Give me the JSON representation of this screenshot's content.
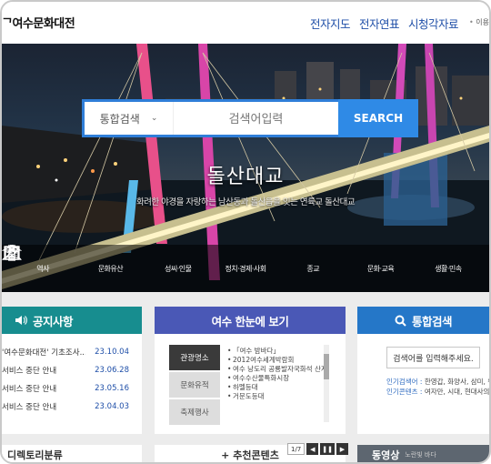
{
  "header": {
    "logo": "ᄀ여수문화대전",
    "nav": [
      "전자지도",
      "전자연표",
      "시청각자료"
    ],
    "util": "이용"
  },
  "search": {
    "select_label": "통합검색",
    "placeholder": "검색어입력",
    "button_label": "SEARCH"
  },
  "hero": {
    "title": "돌산대교",
    "subtitle": "화려한 야경을 자랑하는 남산동과 돌산읍을 잇는 연륙교 돌산대교"
  },
  "categories": [
    {
      "label": "역사",
      "icon": "hourglass-icon"
    },
    {
      "label": "문화유산",
      "icon": "temple-icon"
    },
    {
      "label": "성씨·인물",
      "icon": "people-icon"
    },
    {
      "label": "정치·경제·사회",
      "icon": "gavel-icon"
    },
    {
      "label": "종교",
      "icon": "candle-icon"
    },
    {
      "label": "문화·교육",
      "icon": "book-icon"
    },
    {
      "label": "생활·민속",
      "icon": "house-icon"
    }
  ],
  "notice": {
    "title": "공지사항",
    "items": [
      {
        "text": "'여수문화대전' 기초조사...",
        "date": "23.10.04"
      },
      {
        "text": "서비스 중단 안내",
        "date": "23.06.28"
      },
      {
        "text": "서비스 중단 안내",
        "date": "23.05.16"
      },
      {
        "text": "서비스 중단 안내",
        "date": "23.04.03"
      }
    ]
  },
  "glance": {
    "title": "여수 한눈에 보기",
    "tabs": [
      "관광명소",
      "문화유적",
      "축제행사"
    ],
    "items": [
      "「여수 밤바다」",
      "2012여수세계박람회",
      "여수 낭도리 공룡발자국화석 산지",
      "",
      "여수수산물특화시장",
      "하멜등대",
      "거문도등대"
    ]
  },
  "integrated": {
    "title": "통합검색",
    "input_label": "검색어를 입력해주세요.",
    "hot_label_1": "인기검색어 :",
    "hot_value_1": "한영갑, 화양사, 삼미, 위봉",
    "hot_label_2": "인기콘텐츠 :",
    "hot_value_2": "여자만, 시대, 현대사의, 전라, 굴전, 골프드 LC화학 여수공장"
  },
  "bottom": {
    "directory": "디렉토리분류",
    "recommended": "+ 추천콘텐츠",
    "pager": "1/7",
    "video": "동영상",
    "video_sub": "노란빛 바다"
  },
  "colors": {
    "accent": "#2f8ae6",
    "notice": "#178d8f",
    "glance": "#4a58b6",
    "integrated": "#2577c8"
  }
}
